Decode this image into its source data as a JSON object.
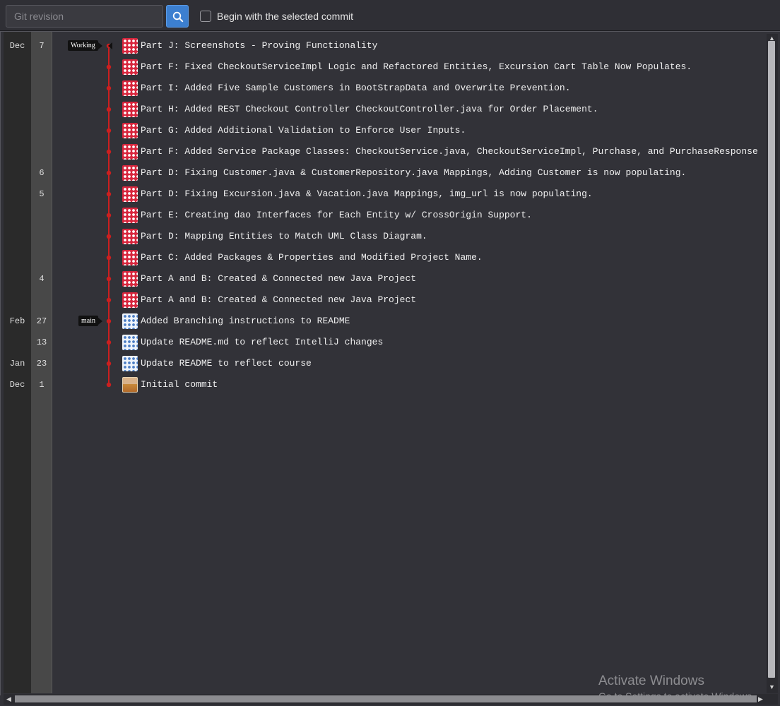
{
  "toolbar": {
    "revision_placeholder": "Git revision",
    "checkbox_label": "Begin with the selected commit"
  },
  "colors": {
    "graph_line": "#cc1f1f",
    "accent": "#3c7fd0",
    "tag_bg": "#111111"
  },
  "commits": [
    {
      "month": "Dec",
      "day": "7",
      "message": "Part J: Screenshots - Proving Functionality",
      "avatar": "red",
      "tag": "Working"
    },
    {
      "month": "",
      "day": "",
      "message": "Part F: Fixed CheckoutServiceImpl Logic and Refactored Entities, Excursion Cart Table Now Populates.",
      "avatar": "red"
    },
    {
      "month": "",
      "day": "",
      "message": "Part I: Added Five Sample Customers in BootStrapData and Overwrite Prevention.",
      "avatar": "red"
    },
    {
      "month": "",
      "day": "",
      "message": "Part H: Added REST Checkout Controller CheckoutController.java for Order Placement.",
      "avatar": "red"
    },
    {
      "month": "",
      "day": "",
      "message": "Part G: Added Additional Validation to Enforce User Inputs.",
      "avatar": "red"
    },
    {
      "month": "",
      "day": "",
      "message": "Part F: Added Service Package Classes: CheckoutService.java, CheckoutServiceImpl, Purchase, and PurchaseResponse",
      "avatar": "red"
    },
    {
      "month": "",
      "day": "6",
      "message": "Part D: Fixing Customer.java & CustomerRepository.java Mappings, Adding Customer is now populating.",
      "avatar": "red"
    },
    {
      "month": "",
      "day": "5",
      "message": "Part D: Fixing Excursion.java & Vacation.java Mappings, img_url is now populating.",
      "avatar": "red"
    },
    {
      "month": "",
      "day": "",
      "message": "Part E: Creating dao Interfaces for Each Entity w/ CrossOrigin Support.",
      "avatar": "red"
    },
    {
      "month": "",
      "day": "",
      "message": "Part D: Mapping Entities to Match UML Class Diagram.",
      "avatar": "red"
    },
    {
      "month": "",
      "day": "",
      "message": "Part C: Added Packages & Properties and Modified Project Name.",
      "avatar": "red"
    },
    {
      "month": "",
      "day": "4",
      "message": "Part A and B: Created & Connected new Java Project",
      "avatar": "red"
    },
    {
      "month": "",
      "day": "",
      "message": "Part A and B: Created & Connected new Java Project",
      "avatar": "red"
    },
    {
      "month": "Feb",
      "day": "27",
      "message": "Added Branching instructions to README",
      "avatar": "blue",
      "tag": "main"
    },
    {
      "month": "",
      "day": "13",
      "message": "Update README.md to reflect IntelliJ changes",
      "avatar": "blue"
    },
    {
      "month": "Jan",
      "day": "23",
      "message": "Update README to reflect course",
      "avatar": "blue"
    },
    {
      "month": "Dec",
      "day": "1",
      "message": "Initial commit",
      "avatar": "photo"
    }
  ],
  "watermark": {
    "title": "Activate Windows",
    "subtitle": "Go to Settings to activate Windows."
  }
}
